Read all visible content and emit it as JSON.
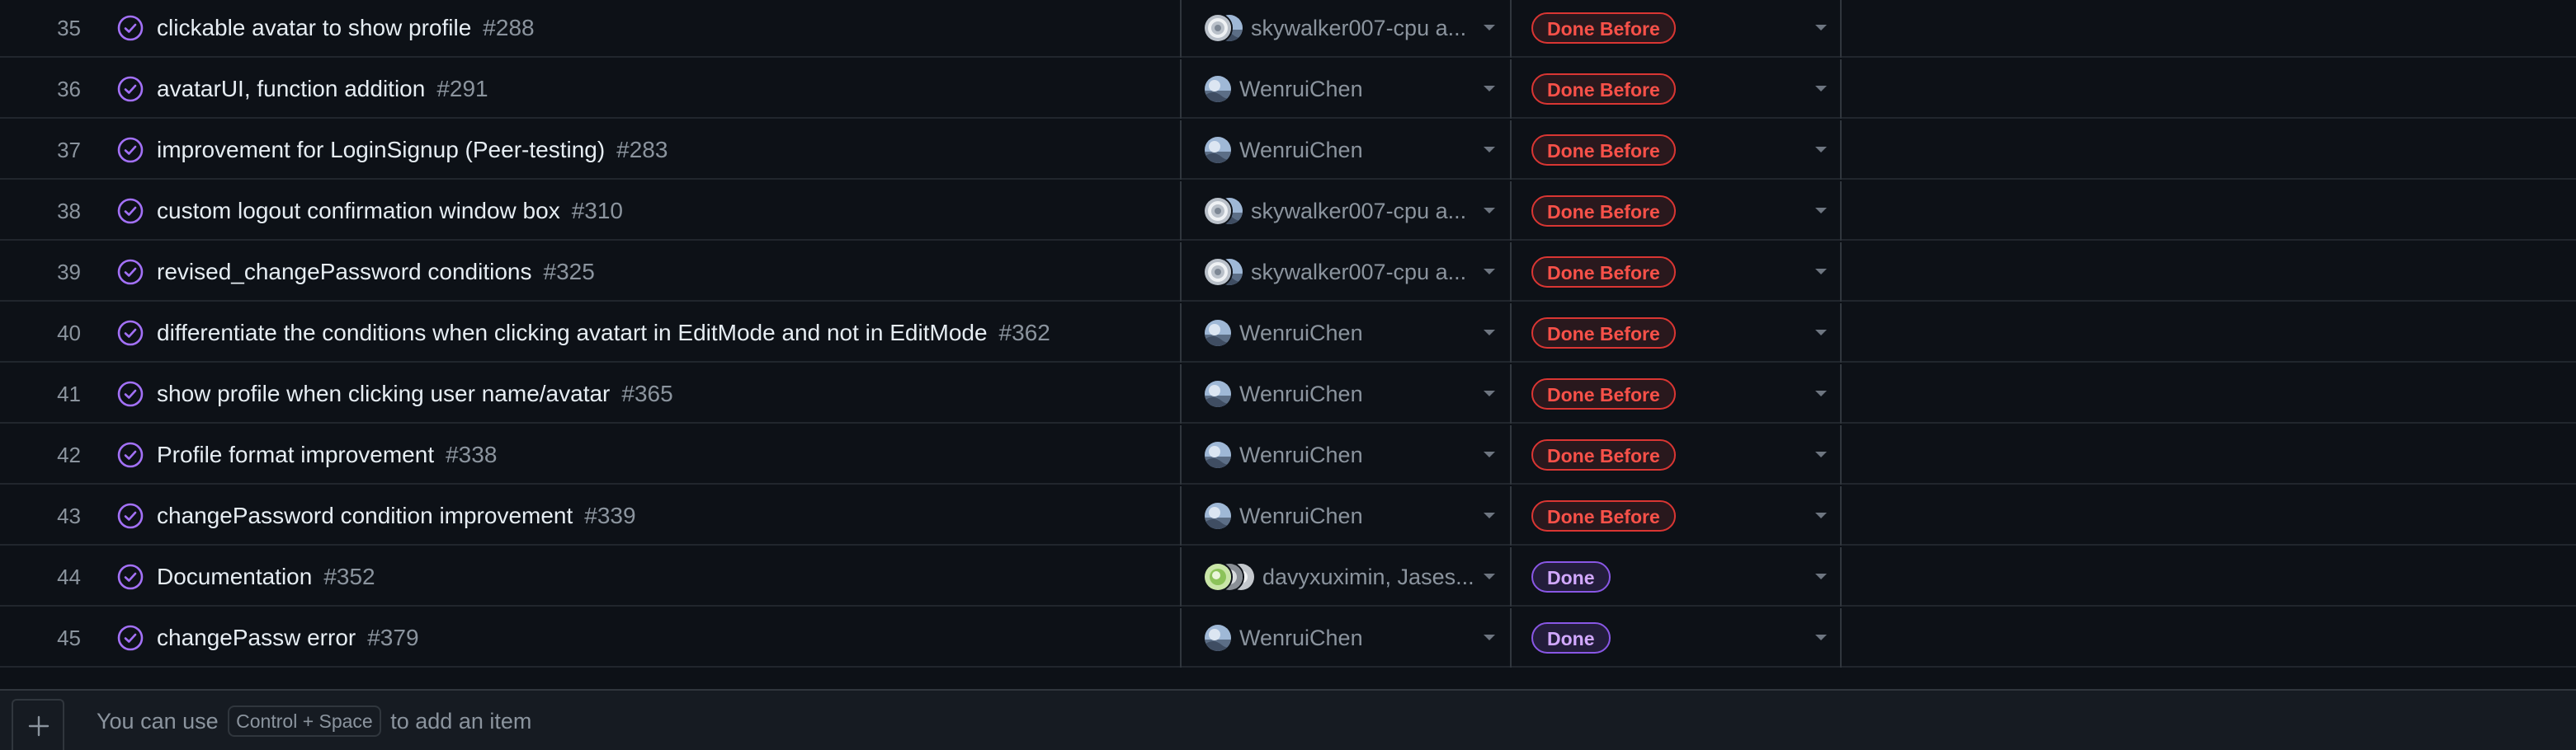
{
  "rows": [
    {
      "num": "35",
      "title": "clickable avatar to show profile",
      "issue": "#288",
      "assignees": "skywalker007-cpu a...",
      "avatars": [
        "swirl-gray",
        "landscape"
      ],
      "status": "Done Before",
      "status_color": "#f85149"
    },
    {
      "num": "36",
      "title": "avatarUI, function addition",
      "issue": "#291",
      "assignees": "WenruiChen",
      "avatars": [
        "landscape"
      ],
      "status": "Done Before",
      "status_color": "#f85149"
    },
    {
      "num": "37",
      "title": "improvement for LoginSignup (Peer-testing)",
      "issue": "#283",
      "assignees": "WenruiChen",
      "avatars": [
        "landscape"
      ],
      "status": "Done Before",
      "status_color": "#f85149"
    },
    {
      "num": "38",
      "title": "custom logout confirmation window box",
      "issue": "#310",
      "assignees": "skywalker007-cpu a...",
      "avatars": [
        "swirl-gray",
        "landscape"
      ],
      "status": "Done Before",
      "status_color": "#f85149"
    },
    {
      "num": "39",
      "title": "revised_changePassword conditions",
      "issue": "#325",
      "assignees": "skywalker007-cpu a...",
      "avatars": [
        "swirl-gray",
        "landscape"
      ],
      "status": "Done Before",
      "status_color": "#f85149"
    },
    {
      "num": "40",
      "title": "differentiate the conditions when clicking avatart in EditMode and not in EditMode",
      "issue": "#362",
      "assignees": "WenruiChen",
      "avatars": [
        "landscape"
      ],
      "status": "Done Before",
      "status_color": "#f85149"
    },
    {
      "num": "41",
      "title": "show profile when clicking user name/avatar",
      "issue": "#365",
      "assignees": "WenruiChen",
      "avatars": [
        "landscape"
      ],
      "status": "Done Before",
      "status_color": "#f85149"
    },
    {
      "num": "42",
      "title": "Profile format improvement",
      "issue": "#338",
      "assignees": "WenruiChen",
      "avatars": [
        "landscape"
      ],
      "status": "Done Before",
      "status_color": "#f85149"
    },
    {
      "num": "43",
      "title": "changePassword condition improvement",
      "issue": "#339",
      "assignees": "WenruiChen",
      "avatars": [
        "landscape"
      ],
      "status": "Done Before",
      "status_color": "#f85149"
    },
    {
      "num": "44",
      "title": "Documentation",
      "issue": "#352",
      "assignees": "davyxuximin, Jases...",
      "avatars": [
        "green",
        "gray-dark",
        "gray-light"
      ],
      "status": "Done",
      "status_color": "#d2a8ff"
    },
    {
      "num": "45",
      "title": "changePassw error",
      "issue": "#379",
      "assignees": "WenruiChen",
      "avatars": [
        "landscape"
      ],
      "status": "Done",
      "status_color": "#d2a8ff"
    }
  ],
  "footer": {
    "hint_prefix": "You can use",
    "shortcut": "Control + Space",
    "hint_suffix": "to add an item"
  },
  "colors": {
    "background": "#0d1117",
    "done_before": "#f85149",
    "done": "#d2a8ff",
    "status_icon": "#a371f7"
  },
  "icons": {
    "row_status": "issue-closed-icon",
    "add": "plus-icon",
    "dropdown": "chevron-down-icon"
  }
}
